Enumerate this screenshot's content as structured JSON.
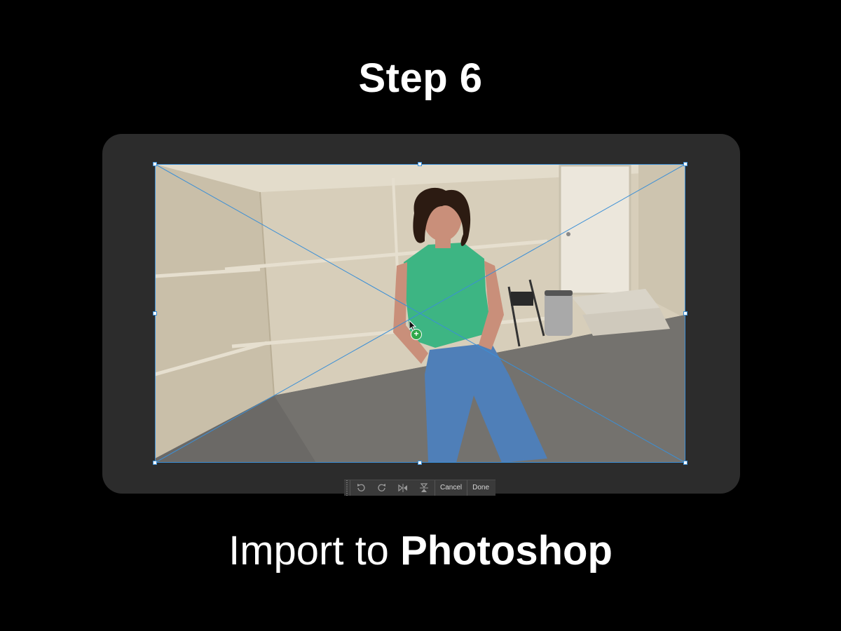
{
  "header": {
    "title": "Step 6"
  },
  "caption": {
    "prefix": "Import to ",
    "emphasis": "Photoshop"
  },
  "toolbar": {
    "undo_icon": "undo-icon",
    "redo_icon": "redo-icon",
    "flip_horizontal_icon": "flip-horizontal-icon",
    "flip_vertical_icon": "flip-vertical-icon",
    "cancel_label": "Cancel",
    "done_label": "Done"
  },
  "colors": {
    "background": "#000000",
    "canvas": "#2c2c2c",
    "transform_guide": "#3b8fd6",
    "cursor_add": "#2fa84a",
    "text": "#ffffff"
  }
}
